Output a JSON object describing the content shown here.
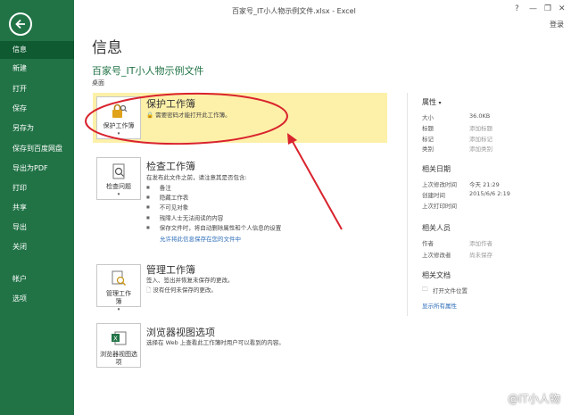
{
  "titlebar": {
    "title": "百家号_IT小人物示例文件.xlsx - Excel",
    "help": "?",
    "minimize": "—",
    "restore": "❐",
    "close": "✕",
    "login": "登录"
  },
  "nav": {
    "items": [
      "信息",
      "新建",
      "打开",
      "保存",
      "另存为",
      "保存到百度网盘",
      "导出为PDF",
      "打印",
      "共享",
      "导出",
      "关闭",
      "帐户",
      "选项"
    ],
    "active": "信息"
  },
  "main": {
    "page_title": "信息",
    "file_name": "百家号_IT小人物示例文件",
    "file_location": "桌面",
    "protect": {
      "button_label": "保护工作簿",
      "title": "保护工作簿",
      "desc": "需要密码才能打开此工作簿。"
    },
    "inspect": {
      "button_label": "检查问题",
      "title": "检查工作簿",
      "desc": "在发布此文件之前，请注意其是否包含:",
      "bullets": [
        "备注",
        "隐藏工作表",
        "不可见对象",
        "残障人士无法阅读的内容",
        "保存文件时，将自动删除属性和个人信息的设置"
      ],
      "link": "允许将此信息保存在您的文件中"
    },
    "manage": {
      "button_label": "管理工作簿",
      "title": "管理工作簿",
      "desc": "签入、签出并恢复未保存的更改。",
      "note": "没有任何未保存的更改。"
    },
    "browser": {
      "button_label": "浏览器视图选项",
      "title": "浏览器视图选项",
      "desc": "选择在 Web 上查看此工作簿时用户可以看到的内容。"
    }
  },
  "properties": {
    "header": "属性",
    "rows": [
      {
        "k": "大小",
        "v": "36.0KB"
      },
      {
        "k": "标题",
        "v": "添加标题"
      },
      {
        "k": "标记",
        "v": "添加标记"
      },
      {
        "k": "类别",
        "v": "添加类别"
      }
    ],
    "dates_header": "相关日期",
    "dates": [
      {
        "k": "上次修改时间",
        "v": "今天 21:29"
      },
      {
        "k": "创建时间",
        "v": "2015/6/6 2:19"
      },
      {
        "k": "上次打印时间",
        "v": ""
      }
    ],
    "people_header": "相关人员",
    "people": [
      {
        "k": "作者",
        "v": "添加作者"
      },
      {
        "k": "上次修改者",
        "v": "尚未保存"
      }
    ],
    "docs_header": "相关文档",
    "open_location": "打开文件位置",
    "show_all": "显示所有属性"
  },
  "watermark": "@IT小人物",
  "colors": {
    "excel_green": "#217346",
    "highlight": "#fdf0a8",
    "annotation_red": "#d9232d",
    "link": "#2b6cb8"
  }
}
